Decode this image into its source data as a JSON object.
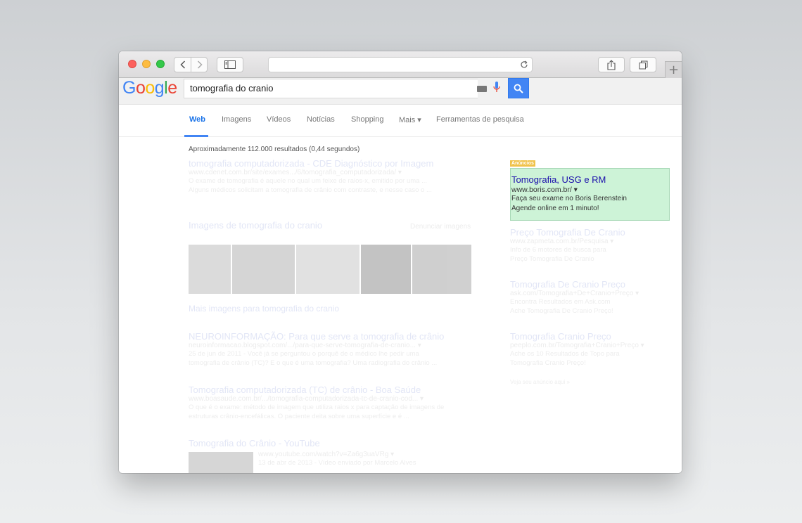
{
  "browser": {
    "new_tab_label": "+"
  },
  "google": {
    "logo_letters": [
      "G",
      "o",
      "o",
      "g",
      "l",
      "e"
    ],
    "logo_colors": [
      "#4285f4",
      "#ea4335",
      "#fbbc05",
      "#4285f4",
      "#34a853",
      "#ea4335"
    ],
    "query": "tomografia do cranio"
  },
  "tabs": [
    {
      "label": "Web",
      "active": true
    },
    {
      "label": "Imagens"
    },
    {
      "label": "Vídeos"
    },
    {
      "label": "Notícias"
    },
    {
      "label": "Shopping"
    },
    {
      "label": "Mais ▾"
    },
    {
      "label": "Ferramentas de pesquisa"
    }
  ],
  "results": {
    "stats": "Aproximadamente 112.000 resultados (0,44 segundos)",
    "items": [
      {
        "title": "tomografia computadorizada - CDE Diagnóstico por Imagem",
        "url": "www.cdenet.com.br/site/exames.../6/tomografia_computadorizada/ ▾",
        "snippet1": "O exame de tomografia é aquele no qual um feixe de raios-x, emitido por uma ...",
        "snippet2": "Alguns médicos solicitam a tomografia de crânio com contraste, e nesse caso o ..."
      },
      {
        "title": "NEUROINFORMAÇÃO: Para que serve a tomografia de crânio",
        "url": "neuroinformacao.blogspot.com/.../para-que-serve-tomografia-de-cranio... ▾",
        "snippet1": "25 de jun de 2011 - Você já se perguntou o porquê de o médico lhe pedir uma",
        "snippet2": "tomografia de crânio (TC)? E o que é uma tomografia? Uma radiografia do crânio ..."
      },
      {
        "title": "Tomografia computadorizada (TC) de crânio - Boa Saúde",
        "url": "www.boasaude.com.br/.../tomografia-computadorizada-tc-de-cranio-cod... ▾",
        "snippet1": "O que é o exame: método de imagem que utiliza raios x para captação de imagens de",
        "snippet2": "estruturas crânio-encefálicas. O paciente deita sobre uma superfície e é ..."
      }
    ],
    "images_heading": "Imagens de tomografia do cranio",
    "images_report": "Denunciar imagens",
    "more_images": "Mais imagens para tomografia do cranio",
    "youtube_title": "Tomografia do Crânio - YouTube",
    "youtube_url": "www.youtube.com/watch?v=Za6g3uaVRg ▾",
    "youtube_date": "13 de abr de 2013 - Vídeo enviado por Marcelo Alves"
  },
  "ads": {
    "label": "Anúncios",
    "highlighted": {
      "title": "Tomografia, USG e RM",
      "url": "www.boris.com.br/ ▾",
      "line1": "Faça seu exame no Boris Berenstein",
      "line2": "Agende online em 1 minuto!"
    },
    "others": [
      {
        "title": "Preço Tomografia De Cranio",
        "url": "www.zapmeta.com.br/Pesquisa ▾",
        "line1": "Info de 6 motores de busca para",
        "line2": "Preço Tomografia De Cranio"
      },
      {
        "title": "Tomografia De Cranio Preço",
        "url": "ask.com/Tomografia+De+Cranio+Preço ▾",
        "line1": "Encontra Resultados em Ask.com",
        "line2": "Ache Tomografia De Cranio Preço!"
      },
      {
        "title": "Tomografia Cranio Preço",
        "url": "peeplo.com.br/Tomografia+Cranio+Preço ▾",
        "line1": "Ache os 10 Resultados de Topo para",
        "line2": "Tomografia Cranio Preço!"
      }
    ],
    "see_your_ad": "Veja seu anúncio aqui »"
  }
}
